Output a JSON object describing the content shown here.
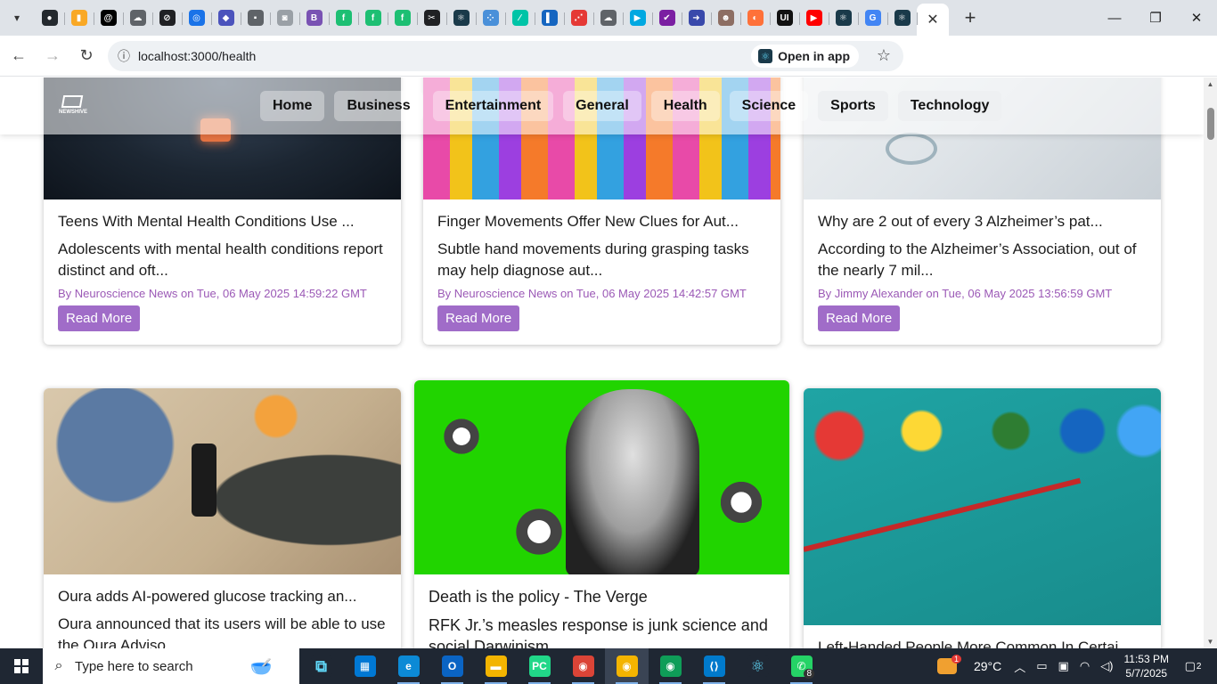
{
  "browser": {
    "tabs": [
      {
        "name": "github-favicon",
        "color": "#24292e",
        "glyph": "●"
      },
      {
        "name": "analytics-favicon",
        "color": "#f9a825",
        "glyph": "▮"
      },
      {
        "name": "threads-favicon",
        "color": "#000000",
        "glyph": "@"
      },
      {
        "name": "cloud-favicon",
        "color": "#5f6368",
        "glyph": "☁"
      },
      {
        "name": "slash-favicon",
        "color": "#202124",
        "glyph": "⊘"
      },
      {
        "name": "globe-favicon",
        "color": "#1a73e8",
        "glyph": "◎"
      },
      {
        "name": "teams-favicon",
        "color": "#4b53bc",
        "glyph": "◆"
      },
      {
        "name": "page-favicon",
        "color": "#5f6368",
        "glyph": "▪"
      },
      {
        "name": "camera-favicon",
        "color": "#9aa0a6",
        "glyph": "◙"
      },
      {
        "name": "bootstrap-favicon",
        "color": "#7952b3",
        "glyph": "B"
      },
      {
        "name": "fiverr-favicon-1",
        "color": "#1dbf73",
        "glyph": "f"
      },
      {
        "name": "fiverr-favicon-2",
        "color": "#1dbf73",
        "glyph": "f"
      },
      {
        "name": "fiverr-favicon-3",
        "color": "#1dbf73",
        "glyph": "f"
      },
      {
        "name": "capcut-favicon",
        "color": "#202124",
        "glyph": "✂"
      },
      {
        "name": "react-favicon-1",
        "color": "#1a3a4a",
        "glyph": "⚛"
      },
      {
        "name": "dots-favicon",
        "color": "#4a90d9",
        "glyph": "⁘"
      },
      {
        "name": "link-favicon",
        "color": "#00c4a7",
        "glyph": "∕"
      },
      {
        "name": "docs-favicon",
        "color": "#1565c0",
        "glyph": "▌"
      },
      {
        "name": "nodes-favicon",
        "color": "#e53935",
        "glyph": "⋰"
      },
      {
        "name": "cloud-favicon-2",
        "color": "#5f6368",
        "glyph": "☁"
      },
      {
        "name": "play-favicon",
        "color": "#00a8e1",
        "glyph": "▶"
      },
      {
        "name": "check-favicon",
        "color": "#7b1fa2",
        "glyph": "✔"
      },
      {
        "name": "arrow-favicon",
        "color": "#3949ab",
        "glyph": "➜"
      },
      {
        "name": "person-favicon",
        "color": "#8d6e63",
        "glyph": "☻"
      },
      {
        "name": "firefox-favicon",
        "color": "#ff7139",
        "glyph": "◐"
      },
      {
        "name": "ui-favicon",
        "color": "#111111",
        "glyph": "UI"
      },
      {
        "name": "youtube-favicon",
        "color": "#ff0000",
        "glyph": "▶"
      },
      {
        "name": "react-favicon-2",
        "color": "#1a3a4a",
        "glyph": "⚛"
      },
      {
        "name": "google-favicon",
        "color": "#4285f4",
        "glyph": "G"
      },
      {
        "name": "react-favicon-3",
        "color": "#1a3a4a",
        "glyph": "⚛"
      }
    ],
    "url": "localhost:3000/health",
    "open_in_app": "Open in app"
  },
  "site": {
    "logo": "NEWSHIVE",
    "nav": [
      "Home",
      "Business",
      "Entertainment",
      "General",
      "Health",
      "Science",
      "Sports",
      "Technology"
    ]
  },
  "articles": [
    {
      "title": "Teens With Mental Health Conditions Use ...",
      "description": "Adolescents with mental health conditions report distinct and oft...",
      "meta": "By Neuroscience News on Tue, 06 May 2025 14:59:22 GMT",
      "button": "Read More"
    },
    {
      "title": "Finger Movements Offer New Clues for Aut...",
      "description": "Subtle hand movements during grasping tasks may help diagnose aut...",
      "meta": "By Neuroscience News on Tue, 06 May 2025 14:42:57 GMT",
      "button": "Read More"
    },
    {
      "title": "Why are 2 out of every 3 Alzheimer’s pat...",
      "description": "According to the Alzheimer’s Association, out of the nearly 7 mil...",
      "meta": "By Jimmy Alexander on Tue, 06 May 2025 13:56:59 GMT",
      "button": "Read More"
    },
    {
      "title": "Oura adds AI-powered glucose tracking an...",
      "description": "Oura announced that its users will be able to use the Oura Adviso..."
    },
    {
      "title": "Death is the policy - The Verge",
      "description": "RFK Jr.’s measles response is junk science and social Darwinism..."
    },
    {
      "title": "Left-Handed People More Common In Certai..."
    }
  ],
  "taskbar": {
    "search_placeholder": "Type here to search",
    "apps": [
      {
        "name": "task-view-icon",
        "color": "#1f2733",
        "glyph": "⧉"
      },
      {
        "name": "store-icon",
        "color": "#0078d4",
        "glyph": "▦"
      },
      {
        "name": "edge-icon",
        "color": "#0c8ad6",
        "glyph": "e"
      },
      {
        "name": "outlook-icon",
        "color": "#0a64c4",
        "glyph": "O"
      },
      {
        "name": "file-explorer-icon",
        "color": "#f3b400",
        "glyph": "▬"
      },
      {
        "name": "pycharm-icon",
        "color": "#21d789",
        "glyph": "PC"
      },
      {
        "name": "chrome-icon-1",
        "color": "#db4437",
        "glyph": "◉"
      },
      {
        "name": "chrome-icon-2",
        "color": "#f4b400",
        "glyph": "◉"
      },
      {
        "name": "chrome-icon-3",
        "color": "#0f9d58",
        "glyph": "◉"
      },
      {
        "name": "vscode-icon",
        "color": "#007acc",
        "glyph": "⟨⟩"
      },
      {
        "name": "react-app-icon",
        "color": "#1f2733",
        "glyph": "⚛"
      },
      {
        "name": "whatsapp-icon",
        "color": "#25d366",
        "glyph": "✆"
      }
    ],
    "whatsapp_badge": "8",
    "weather_badge": "1",
    "temperature": "29°C",
    "time": "11:53 PM",
    "date": "5/7/2025",
    "notifications": "2"
  }
}
